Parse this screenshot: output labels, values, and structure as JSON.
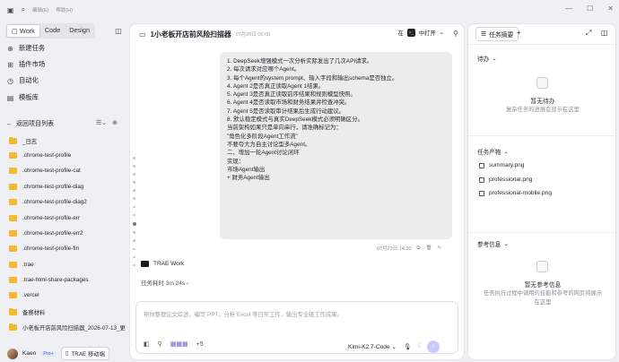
{
  "topbar": {
    "menus": [
      "编辑(E)",
      "帮助(H)"
    ]
  },
  "sidebar": {
    "mode_tabs": [
      "Work",
      "Code",
      "Design"
    ],
    "nav": [
      {
        "label": "新建任务",
        "icon": "new-task-icon"
      },
      {
        "label": "插件市场",
        "icon": "plugin-icon"
      },
      {
        "label": "自动化",
        "icon": "automation-icon"
      },
      {
        "label": "模板库",
        "icon": "template-icon"
      }
    ],
    "section_title": "返回项目列表",
    "folders": [
      "_日志",
      ".chrome-test-profile",
      ".chrome-test-profile-cat",
      ".chrome-test-profile-diag",
      ".chrome-test-profile-diag2",
      ".chrome-test-profile-err",
      ".chrome-test-profile-err2",
      ".chrome-test-profile-fin",
      ".trae",
      ".trae-html-share-packages",
      ".vercel",
      "备赛材料",
      "小老板开店前风险扫描器_2026-07-13_更"
    ],
    "user": {
      "name": "Kaen",
      "badge": "Pro+",
      "mobile_button": "TRAE 移动端"
    }
  },
  "main": {
    "title": "1小老板开店前风险扫描器",
    "date": "07月26日 00:00",
    "open_in": {
      "prefix": "在",
      "label": "中打开"
    },
    "message_lines": [
      "1. DeepSeek增强模式一次分析实际发出了几次API请求。",
      "2. 每次请求对应哪个Agent。",
      "3. 每个Agent的system prompt、输入字段和输出schema是否独立。",
      "4. Agent 2是否真正读取Agent 1结果。",
      "5. Agent 3是否真正读取前序结果和规则模型快照。",
      "6. Agent 4是否读取市场和财务结果并检查冲突。",
      "7. Agent 5是否读取审计结果后生成行动建议。",
      "8. 默认稳定模式与真实DeepSeek模式必须明确区分。",
      "",
      "当前架构如果只是单向串行，请准确标记为：",
      "\"角色化多阶段Agent工作流\"",
      "不要夸大为自主讨论型多Agent。",
      "",
      "二、增加一轮Agent讨论闭环",
      "",
      "实现：",
      "",
      "市场Agent输出",
      "+ 财务Agent输出"
    ],
    "message_time": "07月23日 14:30",
    "agent_label": "TRAE Work",
    "elapsed": "任务耗时 3m 24s",
    "input_placeholder": "帮你整理论文综述、编写 PPT、分析 Excel 等日常工作，输出专业级工作成果。",
    "plus_count": "+5",
    "model": "Kimi-K2.7-Code"
  },
  "right": {
    "tab_label": "任务摘要",
    "todo": {
      "title": "待办",
      "empty_title": "暂无待办",
      "empty_desc": "复杂任务的进展会显示在这里"
    },
    "outputs": {
      "title": "任务产物",
      "files": [
        "summary.png",
        "professional.png",
        "professional-mobile.png"
      ]
    },
    "refs": {
      "title": "参考信息",
      "empty_title": "暂无参考信息",
      "empty_desc": "任务执行过程中调用的技能和参考的网页将展示在这里"
    }
  }
}
